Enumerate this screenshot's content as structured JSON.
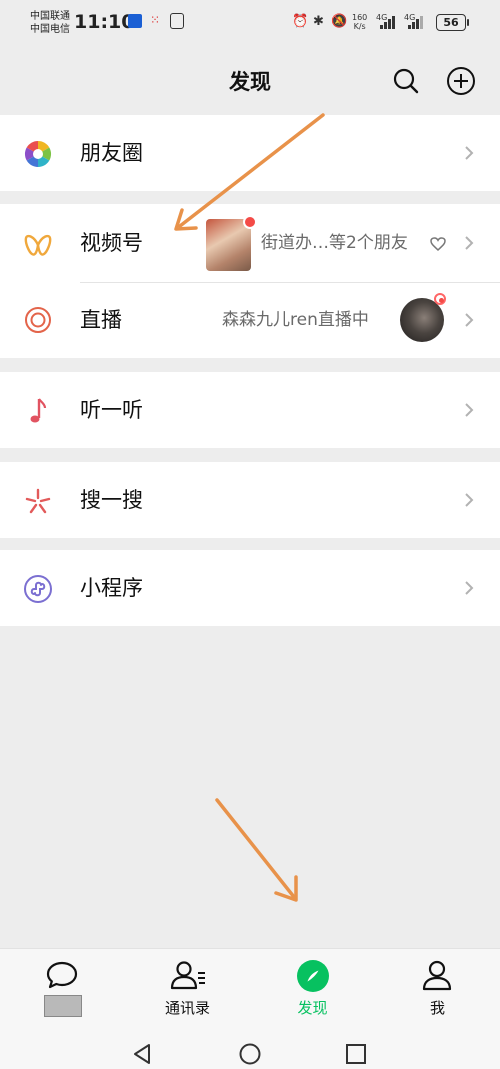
{
  "status_bar": {
    "carrier1": "中国联通",
    "carrier2": "中国电信",
    "time": "11:10",
    "net_speed_value": "160",
    "net_speed_unit": "K/s",
    "signal1_label": "4G",
    "signal2_label": "4G",
    "battery": "56"
  },
  "header": {
    "title": "发现"
  },
  "menu": {
    "moments": {
      "label": "朋友圈"
    },
    "channels": {
      "label": "视频号",
      "detail": "街道办…等2个朋友"
    },
    "live": {
      "label": "直播",
      "detail": "森森九儿ren直播中"
    },
    "listen": {
      "label": "听一听"
    },
    "search": {
      "label": "搜一搜"
    },
    "mini_programs": {
      "label": "小程序"
    }
  },
  "tabbar": {
    "contacts": "通讯录",
    "discover": "发现",
    "me": "我"
  },
  "colors": {
    "accent_green": "#07c160",
    "annotation_arrow": "#e8924a",
    "badge_red": "#f44b47"
  }
}
